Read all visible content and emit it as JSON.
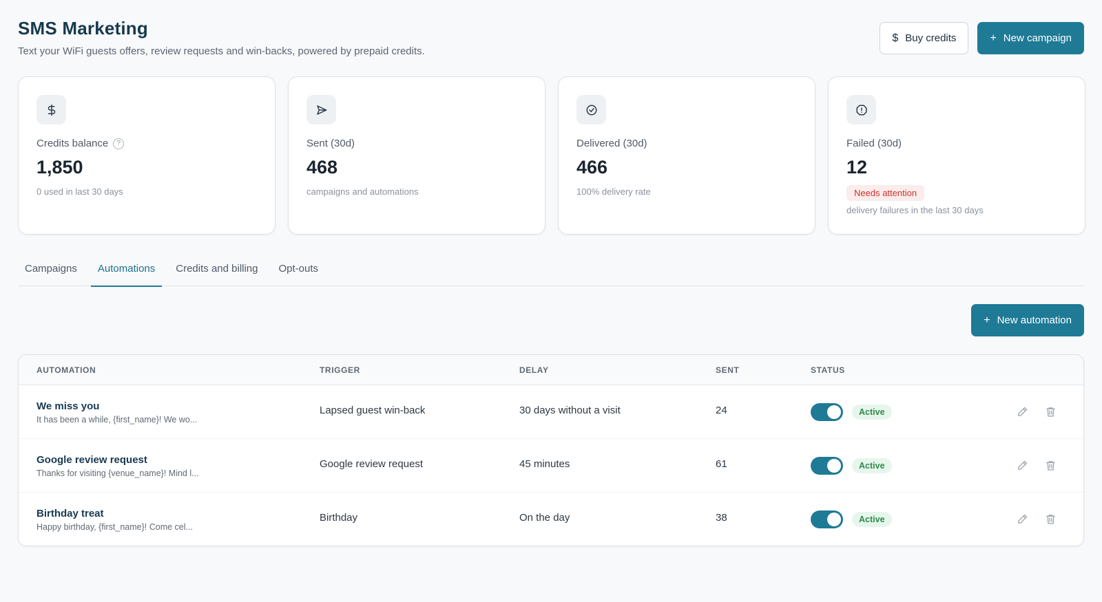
{
  "header": {
    "title": "SMS Marketing",
    "subtitle": "Text your WiFi guests offers, review requests and win-backs, powered by prepaid credits.",
    "buy_credits_label": "Buy credits",
    "new_campaign_label": "New campaign"
  },
  "stats": [
    {
      "icon": "dollar-icon",
      "label": "Credits balance",
      "value": "1,850",
      "note": "0 used in last 30 days"
    },
    {
      "icon": "send-icon",
      "label": "Sent (30d)",
      "value": "468",
      "note": "campaigns and automations"
    },
    {
      "icon": "check-circle-icon",
      "label": "Delivered (30d)",
      "value": "466",
      "note": "100% delivery rate"
    },
    {
      "icon": "alert-octagon-icon",
      "label": "Failed (30d)",
      "value": "12",
      "badge": "Needs attention",
      "note": "delivery failures in the last 30 days"
    }
  ],
  "tabs": [
    {
      "label": "Campaigns",
      "active": false
    },
    {
      "label": "Automations",
      "active": true
    },
    {
      "label": "Credits and billing",
      "active": false
    },
    {
      "label": "Opt-outs",
      "active": false
    }
  ],
  "new_automation_label": "New automation",
  "table": {
    "headers": {
      "automation": "AUTOMATION",
      "trigger": "TRIGGER",
      "delay": "DELAY",
      "sent": "SENT",
      "status": "STATUS"
    },
    "rows": [
      {
        "name": "We miss you",
        "preview": "It has been a while, {first_name}! We wo...",
        "trigger": "Lapsed guest win-back",
        "delay": "30 days without a visit",
        "sent": "24",
        "enabled": true,
        "status": "Active"
      },
      {
        "name": "Google review request",
        "preview": "Thanks for visiting {venue_name}! Mind l...",
        "trigger": "Google review request",
        "delay": "45 minutes",
        "sent": "61",
        "enabled": true,
        "status": "Active"
      },
      {
        "name": "Birthday treat",
        "preview": "Happy birthday, {first_name}! Come cel...",
        "trigger": "Birthday",
        "delay": "On the day",
        "sent": "38",
        "enabled": true,
        "status": "Active"
      }
    ]
  },
  "colors": {
    "primary": "#1f7a96",
    "active_badge_bg": "#e7f6ec",
    "active_badge_text": "#2f8a4a",
    "attention_bg": "#fdecec",
    "attention_text": "#c8342c"
  }
}
